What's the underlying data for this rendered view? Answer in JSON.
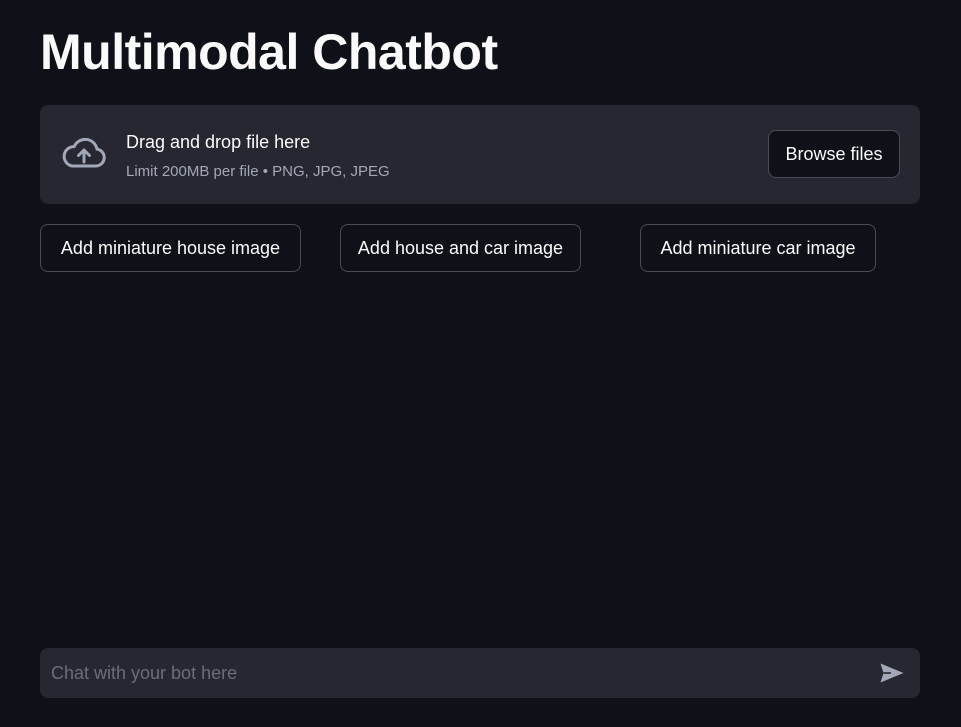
{
  "page": {
    "title": "Multimodal Chatbot"
  },
  "uploader": {
    "icon": "cloud-upload-icon",
    "drop_label": "Drag and drop file here",
    "limit_text": "Limit 200MB per file • PNG, JPG, JPEG",
    "browse_label": "Browse files"
  },
  "image_buttons": [
    {
      "label": "Add miniature house image"
    },
    {
      "label": "Add house and car image"
    },
    {
      "label": "Add miniature car image"
    }
  ],
  "chat": {
    "placeholder": "Chat with your bot here",
    "send_icon": "send-icon"
  },
  "colors": {
    "background": "#0e1117",
    "panel": "#262730",
    "text": "#fafafa",
    "muted_text": "#a3a8b8",
    "border": "#4a4d58"
  }
}
